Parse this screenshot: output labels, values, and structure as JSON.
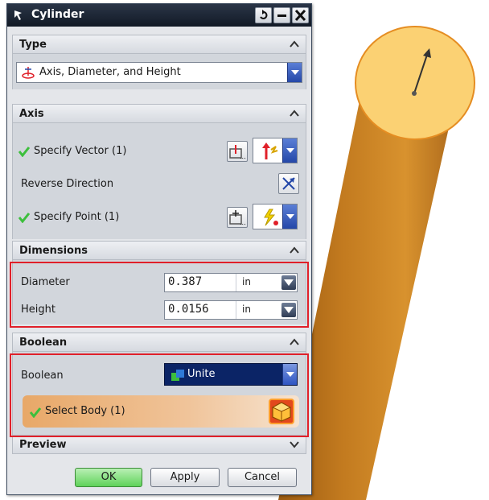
{
  "window": {
    "title": "Cylinder"
  },
  "type_section": {
    "header": "Type",
    "type_value": "Axis, Diameter, and Height"
  },
  "axis_section": {
    "header": "Axis",
    "specify_vector_label": "Specify Vector (1)",
    "reverse_direction_label": "Reverse Direction",
    "specify_point_label": "Specify Point (1)"
  },
  "dimensions_section": {
    "header": "Dimensions",
    "diameter_label": "Diameter",
    "diameter_value": "0.387",
    "diameter_unit": "in",
    "height_label": "Height",
    "height_value": "0.0156",
    "height_unit": "in"
  },
  "boolean_section": {
    "header": "Boolean",
    "boolean_label": "Boolean",
    "boolean_value": "Unite",
    "select_body_label": "Select Body (1)"
  },
  "preview_section": {
    "header": "Preview"
  },
  "buttons": {
    "ok": "OK",
    "apply": "Apply",
    "cancel": "Cancel"
  },
  "colors": {
    "cylinder_body": "#c27a1f",
    "cylinder_top": "#fbd173",
    "highlight_box": "#e0202a",
    "check_green": "#3cbf3c",
    "boolean_field": "#0b2466"
  },
  "icons": {
    "title": "cylinder-command-icon",
    "vector": "vector-arrow-icon",
    "point": "point-lightning-icon",
    "reverse": "reverse-direction-icon",
    "select_body": "solid-body-icon"
  }
}
